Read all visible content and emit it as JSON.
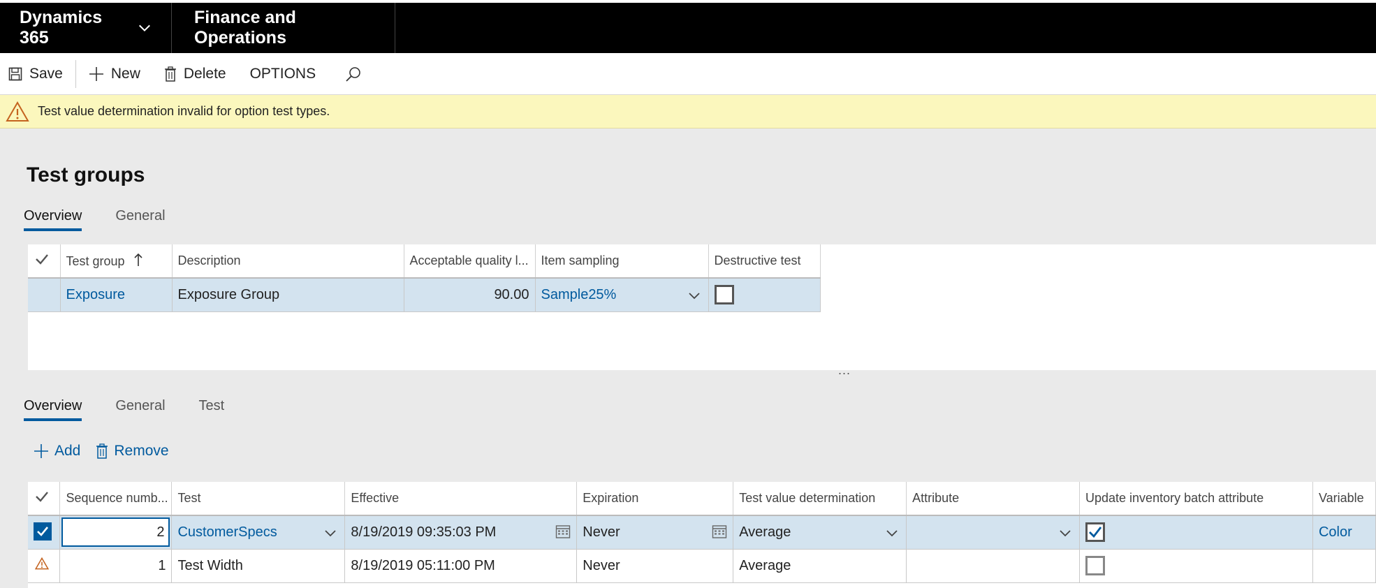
{
  "nav": {
    "app_name": "Dynamics 365",
    "module_name": "Finance and Operations"
  },
  "toolbar": {
    "save_label": "Save",
    "new_label": "New",
    "delete_label": "Delete",
    "options_label": "OPTIONS"
  },
  "warning": {
    "message": "Test value determination invalid for option test types."
  },
  "page": {
    "title": "Test groups"
  },
  "header_tabs": [
    "Overview",
    "General"
  ],
  "header_grid": {
    "columns": [
      "Test group",
      "Description",
      "Acceptable quality l...",
      "Item sampling",
      "Destructive test"
    ],
    "rows": [
      {
        "test_group": "Exposure",
        "description": "Exposure Group",
        "aql": "90.00",
        "item_sampling": "Sample25%",
        "destructive": false
      }
    ]
  },
  "splitter": "...",
  "lines_tabs": [
    "Overview",
    "General",
    "Test"
  ],
  "lines_actions": {
    "add_label": "Add",
    "remove_label": "Remove"
  },
  "lines_grid": {
    "columns": [
      "Sequence numb...",
      "Test",
      "Effective",
      "Expiration",
      "Test value determination",
      "Attribute",
      "Update inventory batch attribute",
      "Variable"
    ],
    "rows": [
      {
        "sequence": "2",
        "test": "CustomerSpecs",
        "effective": "8/19/2019 09:35:03 PM",
        "expiration": "Never",
        "determination": "Average",
        "attribute": "",
        "update_batch": true,
        "variable": "Color"
      },
      {
        "sequence": "1",
        "test": "Test Width",
        "effective": "8/19/2019 05:11:00 PM",
        "expiration": "Never",
        "determination": "Average",
        "attribute": "",
        "update_batch": false,
        "variable": ""
      }
    ]
  },
  "colors": {
    "accent": "#005a9e",
    "nav_bg": "#000000",
    "warning_bg": "#fbf7bd",
    "selected_row": "#d3e3ef"
  }
}
